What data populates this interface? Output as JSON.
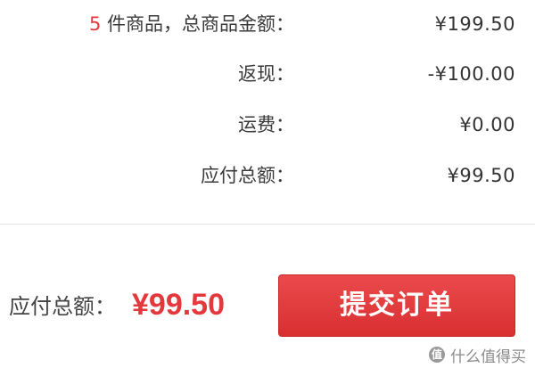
{
  "summary": {
    "item_count": "5",
    "items_total_label": " 件商品，总商品金额：",
    "items_total_value": "¥199.50",
    "cashback_label": "返现：",
    "cashback_value": "-¥100.00",
    "shipping_label": "运费：",
    "shipping_value": "¥0.00",
    "payable_label": "应付总额：",
    "payable_value": "¥99.50"
  },
  "footer": {
    "total_label": "应付总额：",
    "total_amount": "¥99.50",
    "submit_label": "提交订单"
  },
  "watermark": {
    "icon_text": "值",
    "text": "什么值得买"
  },
  "colors": {
    "accent": "#e4393c",
    "button": "#e03a3c"
  }
}
